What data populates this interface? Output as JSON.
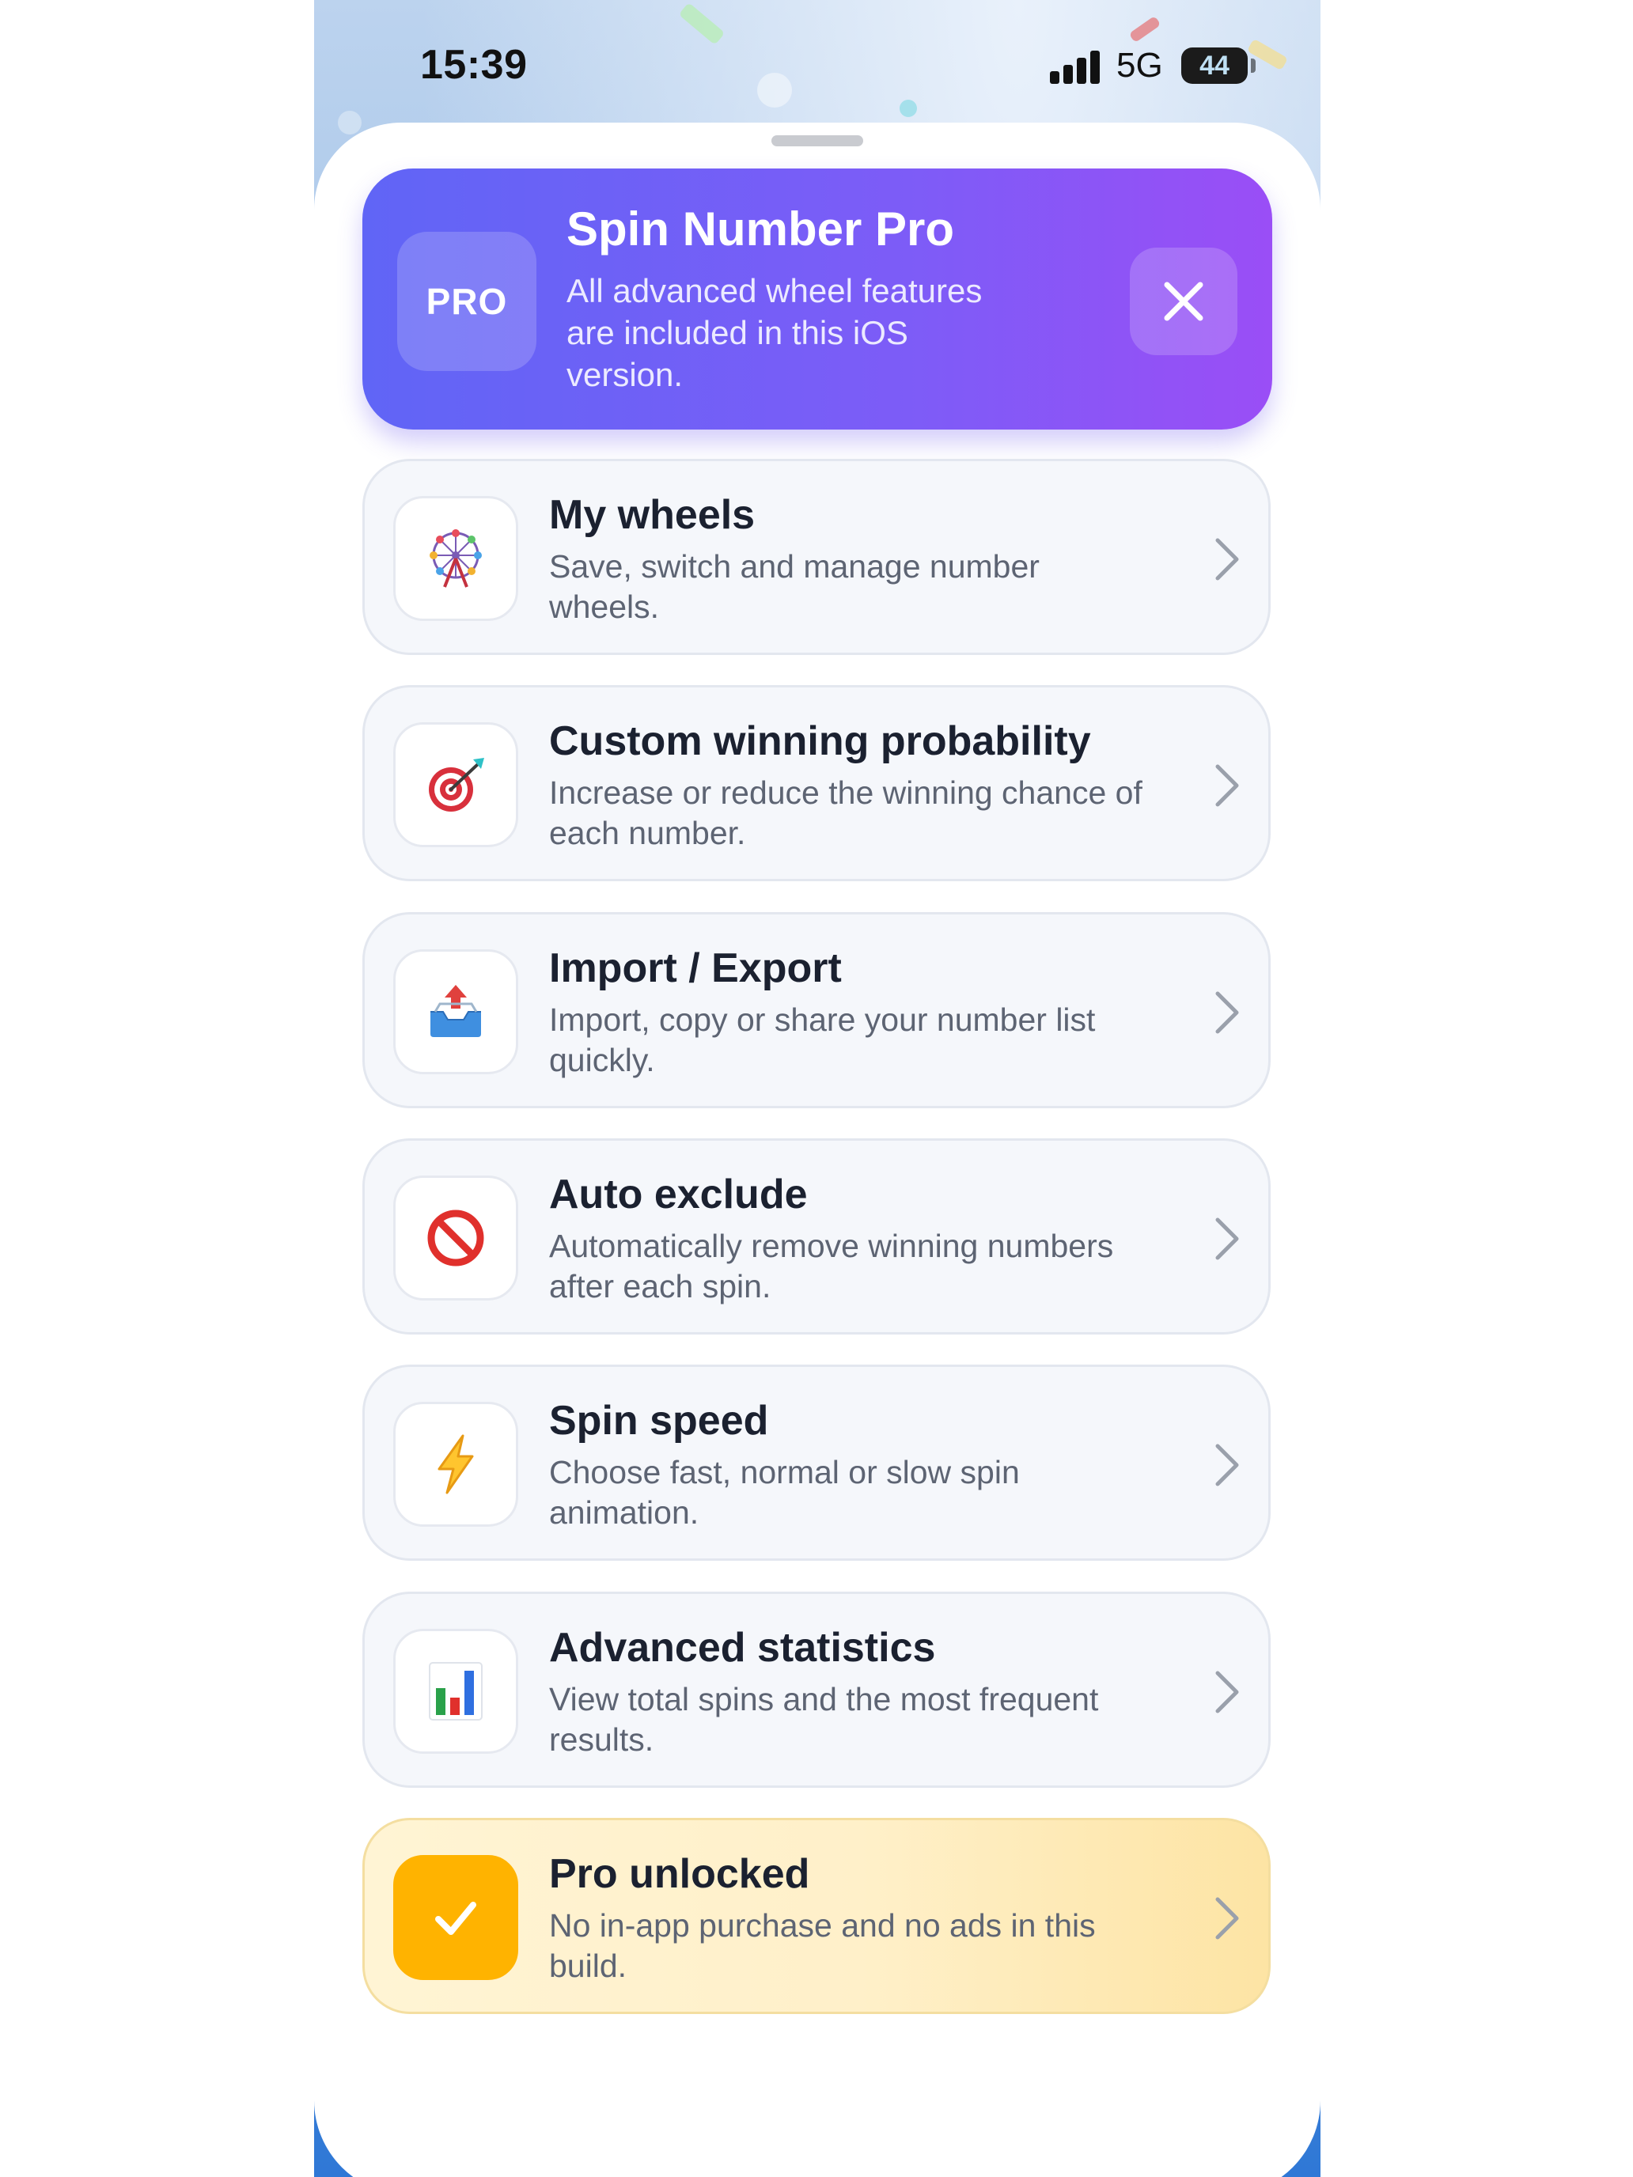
{
  "status_bar": {
    "time": "15:39",
    "network": "5G",
    "battery": "44"
  },
  "banner": {
    "badge": "PRO",
    "title": "Spin Number Pro",
    "subtitle": "All advanced wheel features are included in this iOS version.",
    "close_icon": "close-icon"
  },
  "features": [
    {
      "title": "My wheels",
      "description": "Save, switch and manage number wheels.",
      "icon": "ferris-wheel-icon"
    },
    {
      "title": "Custom winning probability",
      "description": "Increase or reduce the winning chance of each number.",
      "icon": "target-dart-icon"
    },
    {
      "title": "Import / Export",
      "description": "Import, copy or share your number list quickly.",
      "icon": "inbox-upload-icon"
    },
    {
      "title": "Auto exclude",
      "description": "Automatically remove winning numbers after each spin.",
      "icon": "prohibited-icon"
    },
    {
      "title": "Spin speed",
      "description": "Choose fast, normal or slow spin animation.",
      "icon": "lightning-icon"
    },
    {
      "title": "Advanced statistics",
      "description": "View total spins and the most frequent results.",
      "icon": "bar-chart-icon"
    },
    {
      "title": "Pro unlocked",
      "description": "No in-app purchase and no ads in this build.",
      "icon": "checkmark-icon"
    }
  ],
  "colors": {
    "banner_start": "#6065f6",
    "banner_end": "#9a4ef6",
    "card_bg": "#f5f7fb",
    "gold_badge": "#ffb300"
  }
}
